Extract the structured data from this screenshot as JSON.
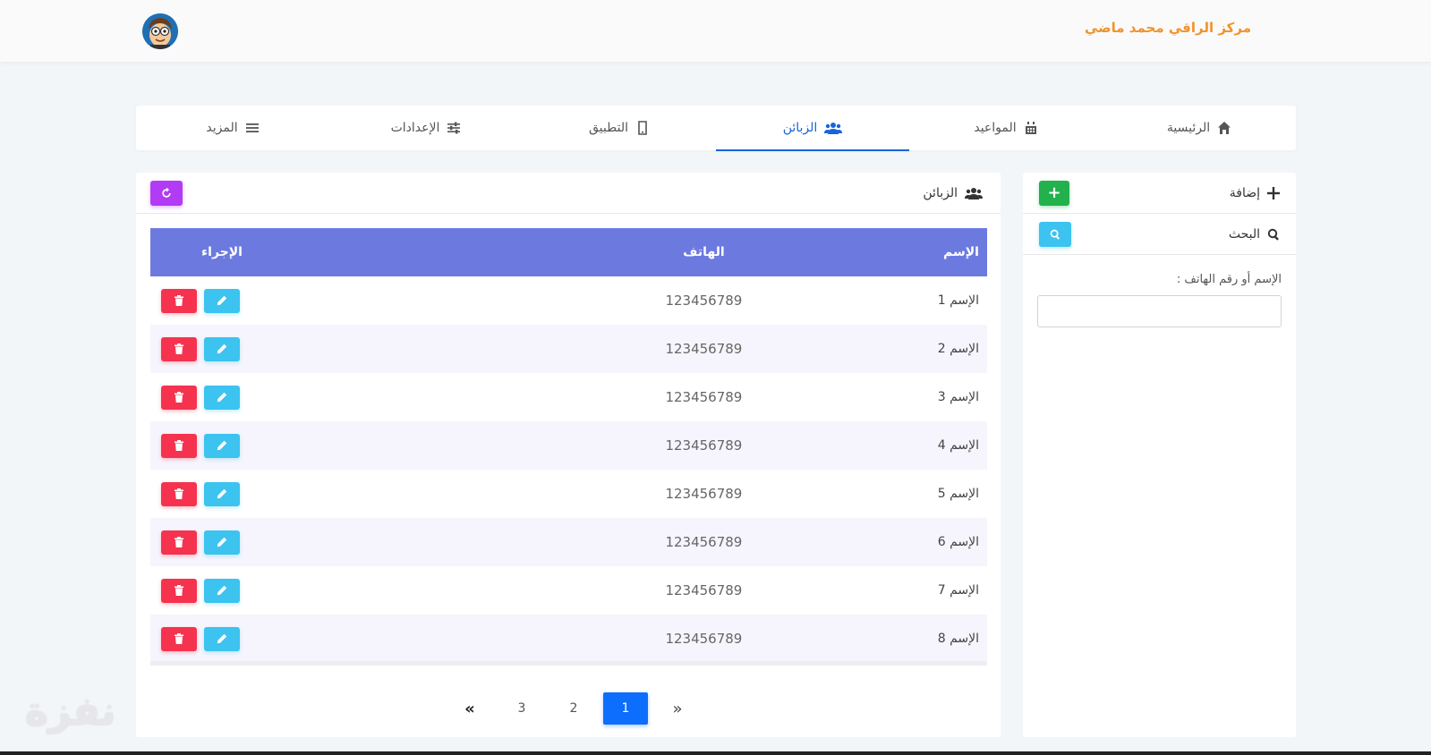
{
  "header": {
    "brand": "مركز الراقي محمد ماضي"
  },
  "nav": {
    "items": [
      {
        "label": "الرئيسية",
        "icon": "home-icon"
      },
      {
        "label": "المواعيد",
        "icon": "calendar-icon"
      },
      {
        "label": "الزبائن",
        "icon": "users-icon",
        "active": true
      },
      {
        "label": "التطبيق",
        "icon": "mobile-icon"
      },
      {
        "label": "الإعدادات",
        "icon": "sliders-icon"
      },
      {
        "label": "المزيد",
        "icon": "menu-icon"
      }
    ]
  },
  "side": {
    "add_label": "إضافة",
    "add_button": "+",
    "search_label": "البحث",
    "field_label": "الإسم أو رقم الهاتف :",
    "field_placeholder": ""
  },
  "main": {
    "title": "الزبائن",
    "columns": {
      "name": "الإسم",
      "phone": "الهاتف",
      "action": "الإجراء"
    },
    "rows": [
      {
        "name": "الإسم 1",
        "phone": "123456789"
      },
      {
        "name": "الإسم 2",
        "phone": "123456789"
      },
      {
        "name": "الإسم 3",
        "phone": "123456789"
      },
      {
        "name": "الإسم 4",
        "phone": "123456789"
      },
      {
        "name": "الإسم 5",
        "phone": "123456789"
      },
      {
        "name": "الإسم 6",
        "phone": "123456789"
      },
      {
        "name": "الإسم 7",
        "phone": "123456789"
      },
      {
        "name": "الإسم 8",
        "phone": "123456789"
      }
    ]
  },
  "pagination": {
    "first": "«",
    "pages": [
      "3",
      "2",
      "1"
    ],
    "active": "1",
    "last": "»"
  },
  "watermark": "نفزة",
  "colors": {
    "brand": "#f0932b",
    "active_nav": "#1665d8",
    "table_header": "#6c7ae0",
    "add": "#22b14c",
    "search": "#3cc3f0",
    "refresh": "#b23cf5",
    "delete": "#f5334f",
    "edit": "#3cc3f0",
    "page_active": "#0d6efd"
  }
}
